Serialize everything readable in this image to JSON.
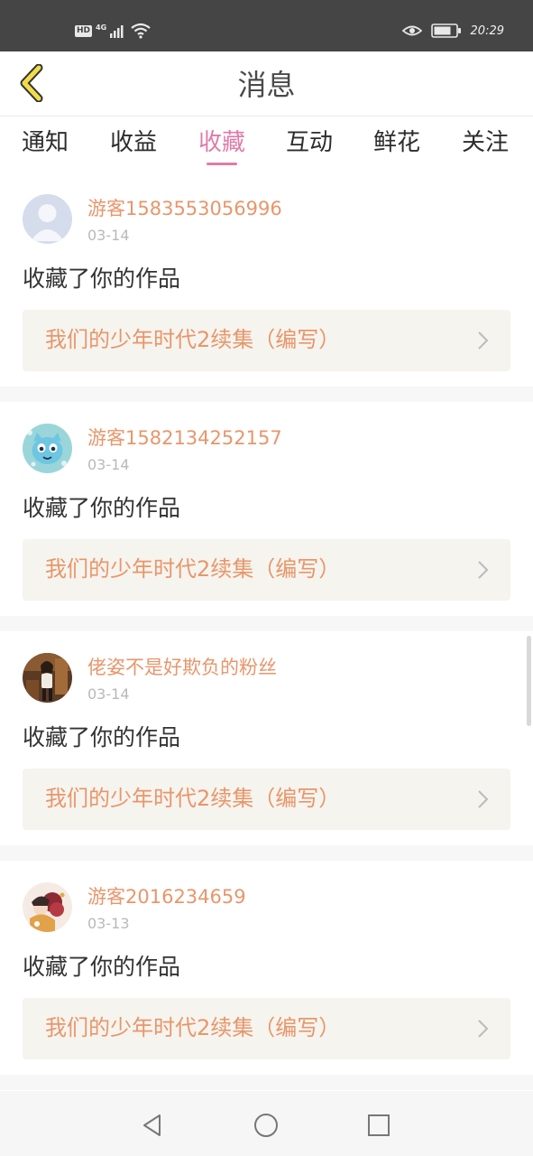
{
  "status_bar": {
    "hd": "HD",
    "network": "4G",
    "time": "20:29",
    "icons": [
      "signal-icon",
      "wifi-icon",
      "eye-icon",
      "battery-icon"
    ]
  },
  "header": {
    "title": "消息",
    "back_icon": "chevron-left-icon"
  },
  "tabs": [
    {
      "label": "通知",
      "active": false
    },
    {
      "label": "收益",
      "active": false
    },
    {
      "label": "收藏",
      "active": true
    },
    {
      "label": "互动",
      "active": false
    },
    {
      "label": "鲜花",
      "active": false
    },
    {
      "label": "关注",
      "active": false
    }
  ],
  "messages": [
    {
      "username": "游客1583553056996",
      "date": "03-14",
      "action": "收藏了你的作品",
      "work": "我们的少年时代2续集（编写）",
      "avatar": "default-avatar-icon"
    },
    {
      "username": "游客1582134252157",
      "date": "03-14",
      "action": "收藏了你的作品",
      "work": "我们的少年时代2续集（编写）",
      "avatar": "cartoon-avatar-icon"
    },
    {
      "username": "佬姿不是好欺负的粉丝",
      "date": "03-14",
      "action": "收藏了你的作品",
      "work": "我们的少年时代2续集（编写）",
      "avatar": "photo-avatar-icon"
    },
    {
      "username": "游客2016234659",
      "date": "03-13",
      "action": "收藏了你的作品",
      "work": "我们的少年时代2续集（编写）",
      "avatar": "anime-avatar-icon"
    }
  ],
  "colors": {
    "accent": "#e07ba9",
    "username": "#e8966b",
    "status_bar_bg": "#454545",
    "work_link_bg": "#f6f4ee"
  },
  "nav_bar": {
    "icons": [
      "back-triangle-icon",
      "home-circle-icon",
      "recents-square-icon"
    ]
  }
}
